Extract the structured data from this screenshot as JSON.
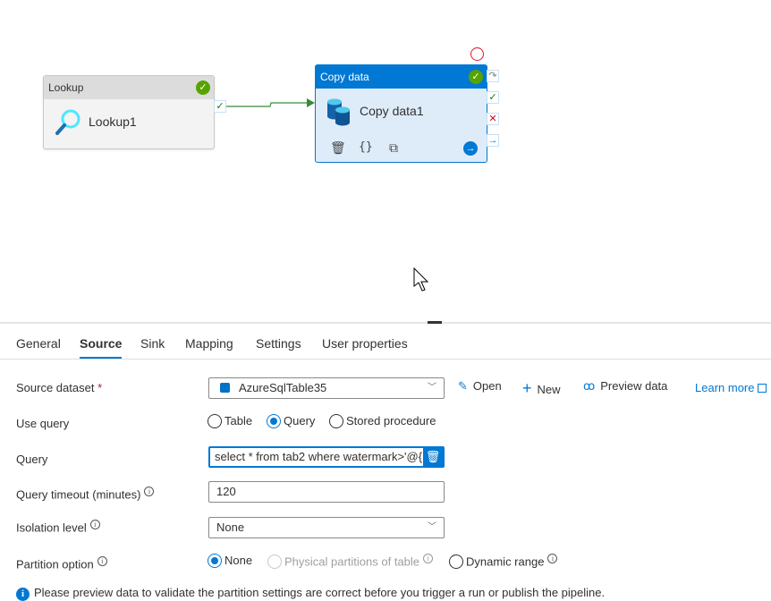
{
  "canvas": {
    "lookup_node": {
      "type_label": "Lookup",
      "name": "Lookup1",
      "status": "success"
    },
    "copy_node": {
      "type_label": "Copy data",
      "name": "Copy data1",
      "status": "success",
      "actions": [
        "delete",
        "code",
        "clone",
        "go"
      ],
      "ports": [
        "skip",
        "success",
        "failure",
        "completion"
      ]
    },
    "connector": {
      "from": "Lookup1",
      "to": "Copy data1",
      "condition": "success"
    }
  },
  "tabs": [
    {
      "label": "General",
      "active": false
    },
    {
      "label": "Source",
      "active": true
    },
    {
      "label": "Sink",
      "active": false
    },
    {
      "label": "Mapping",
      "active": false
    },
    {
      "label": "Settings",
      "active": false
    },
    {
      "label": "User properties",
      "active": false
    }
  ],
  "source": {
    "dataset_label": "Source dataset",
    "required_mark": "*",
    "dataset_value": "AzureSqlTable35",
    "open_label": "Open",
    "new_label": "New",
    "preview_label": "Preview data",
    "learn_more_label": "Learn more",
    "use_query_label": "Use query",
    "use_query_options": [
      {
        "label": "Table",
        "selected": false
      },
      {
        "label": "Query",
        "selected": true
      },
      {
        "label": "Stored procedure",
        "selected": false
      }
    ],
    "query_label": "Query",
    "query_value": "select * from tab2 where watermark>'@{",
    "timeout_label": "Query timeout (minutes)",
    "timeout_value": "120",
    "isolation_label": "Isolation level",
    "isolation_value": "None",
    "partition_label": "Partition option",
    "partition_options": [
      {
        "label": "None",
        "selected": true,
        "disabled": false
      },
      {
        "label": "Physical partitions of table",
        "selected": false,
        "disabled": true
      },
      {
        "label": "Dynamic range",
        "selected": false,
        "disabled": false
      }
    ],
    "notice": "Please preview data to validate the partition settings are correct before you trigger a run or publish the pipeline."
  },
  "colors": {
    "accent": "#0078d4",
    "success": "#57a300",
    "error": "#e81123"
  }
}
